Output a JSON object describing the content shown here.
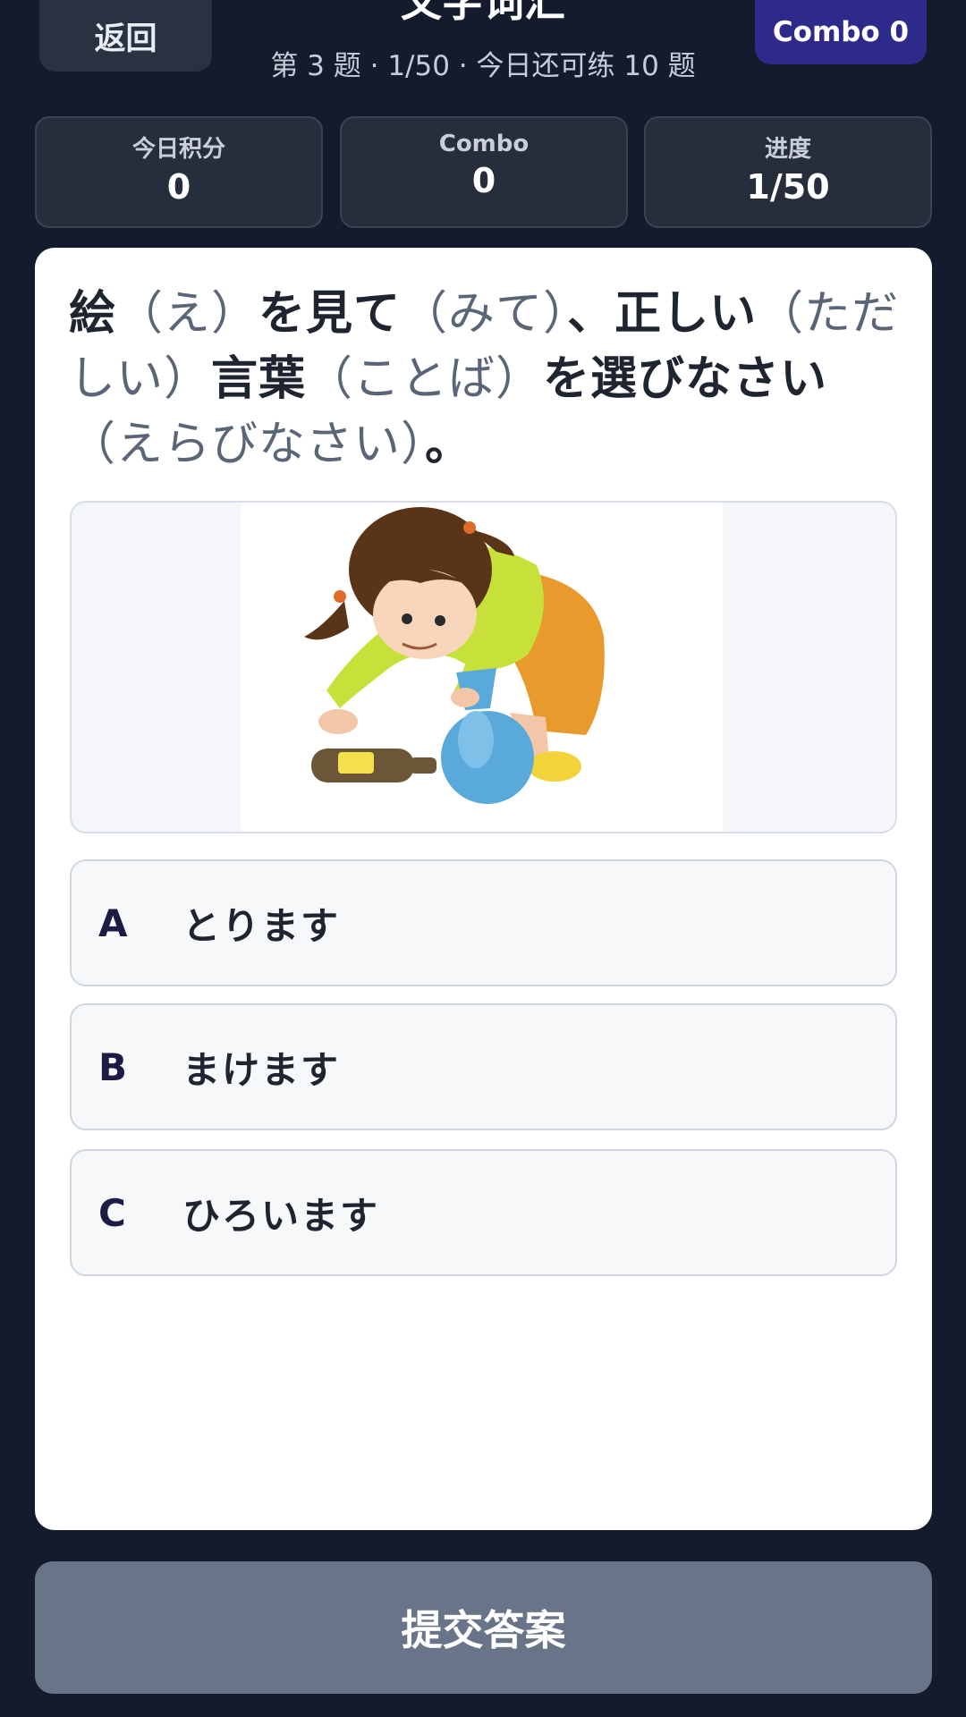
{
  "header": {
    "back_label": "返回",
    "title": "文字词汇",
    "subtitle": "第 3 题 · 1/50 · 今日还可练 10 题",
    "combo_badge": "Combo 0"
  },
  "stats": [
    {
      "label": "今日积分",
      "value": "0"
    },
    {
      "label": "Combo",
      "value": "0"
    },
    {
      "label": "进度",
      "value": "1/50"
    }
  ],
  "question": {
    "segments": [
      {
        "text": "絵",
        "reading": false
      },
      {
        "text": "（え）",
        "reading": true
      },
      {
        "text": "を見て",
        "reading": false
      },
      {
        "text": "（みて）",
        "reading": true
      },
      {
        "text": "、正しい",
        "reading": false
      },
      {
        "text": "（ただしい）",
        "reading": true
      },
      {
        "text": "言葉",
        "reading": false
      },
      {
        "text": "（ことば）",
        "reading": true
      },
      {
        "text": "を選びなさい",
        "reading": false
      },
      {
        "text": "（えらびなさい）",
        "reading": true
      },
      {
        "text": "。",
        "reading": false
      }
    ],
    "image_icon": "girl-picking-up-trash-illustration"
  },
  "options": [
    {
      "letter": "A",
      "text": "とります"
    },
    {
      "letter": "B",
      "text": "まけます"
    },
    {
      "letter": "C",
      "text": "ひろいます"
    }
  ],
  "submit_label": "提交答案",
  "colors": {
    "background": "#141b2d",
    "card": "#ffffff",
    "combo_badge": "#2e2a8c",
    "submit_disabled": "#687487"
  }
}
